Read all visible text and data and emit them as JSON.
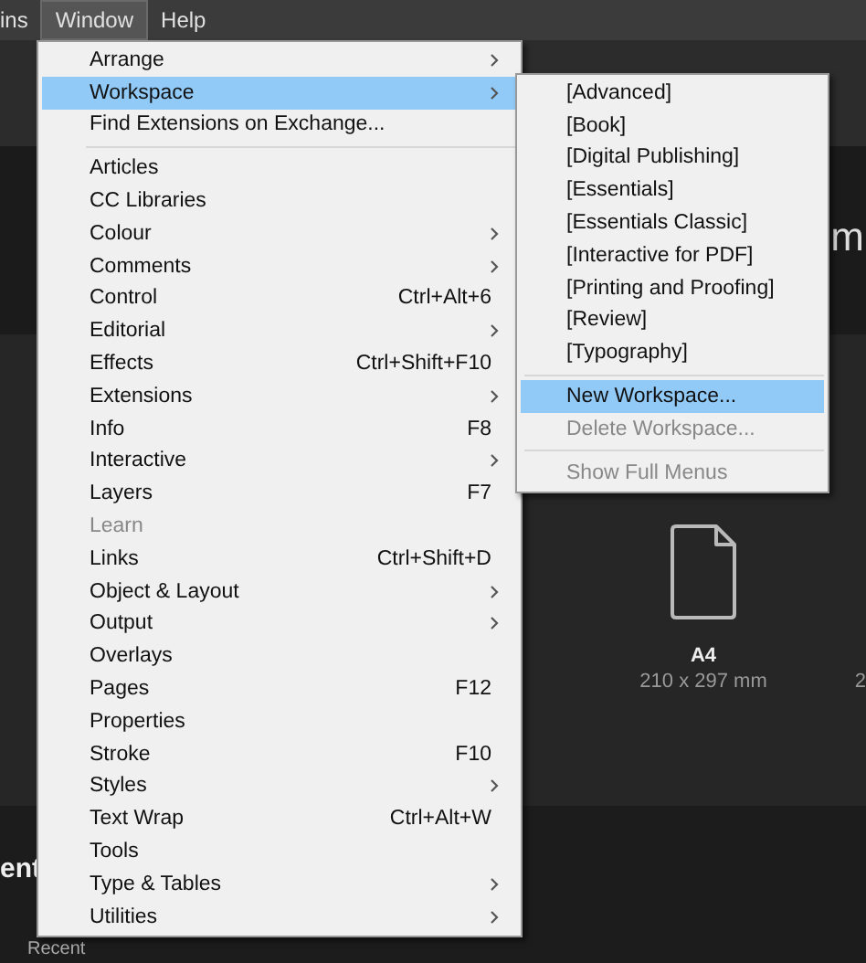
{
  "menubar": [
    {
      "label": "ins",
      "selected": false
    },
    {
      "label": "Window",
      "selected": true
    },
    {
      "label": "Help",
      "selected": false
    }
  ],
  "window_menu": [
    {
      "kind": "item",
      "label": "Arrange",
      "submenu": true,
      "highlighted": false,
      "disabled": false
    },
    {
      "kind": "item",
      "label": "Workspace",
      "submenu": true,
      "highlighted": true,
      "disabled": false
    },
    {
      "kind": "item",
      "label": "Find Extensions on Exchange...",
      "submenu": false,
      "highlighted": false,
      "disabled": false
    },
    {
      "kind": "separator"
    },
    {
      "kind": "item",
      "label": "Articles",
      "submenu": false,
      "highlighted": false,
      "disabled": false
    },
    {
      "kind": "item",
      "label": "CC Libraries",
      "submenu": false,
      "highlighted": false,
      "disabled": false
    },
    {
      "kind": "item",
      "label": "Colour",
      "submenu": true,
      "highlighted": false,
      "disabled": false
    },
    {
      "kind": "item",
      "label": "Comments",
      "submenu": true,
      "highlighted": false,
      "disabled": false
    },
    {
      "kind": "item",
      "label": "Control",
      "shortcut": "Ctrl+Alt+6",
      "submenu": false,
      "highlighted": false,
      "disabled": false
    },
    {
      "kind": "item",
      "label": "Editorial",
      "submenu": true,
      "highlighted": false,
      "disabled": false
    },
    {
      "kind": "item",
      "label": "Effects",
      "shortcut": "Ctrl+Shift+F10",
      "submenu": false,
      "highlighted": false,
      "disabled": false
    },
    {
      "kind": "item",
      "label": "Extensions",
      "submenu": true,
      "highlighted": false,
      "disabled": false
    },
    {
      "kind": "item",
      "label": "Info",
      "shortcut": "F8",
      "submenu": false,
      "highlighted": false,
      "disabled": false
    },
    {
      "kind": "item",
      "label": "Interactive",
      "submenu": true,
      "highlighted": false,
      "disabled": false
    },
    {
      "kind": "item",
      "label": "Layers",
      "shortcut": "F7",
      "submenu": false,
      "highlighted": false,
      "disabled": false
    },
    {
      "kind": "item",
      "label": "Learn",
      "submenu": false,
      "highlighted": false,
      "disabled": true
    },
    {
      "kind": "item",
      "label": "Links",
      "shortcut": "Ctrl+Shift+D",
      "submenu": false,
      "highlighted": false,
      "disabled": false
    },
    {
      "kind": "item",
      "label": "Object & Layout",
      "submenu": true,
      "highlighted": false,
      "disabled": false
    },
    {
      "kind": "item",
      "label": "Output",
      "submenu": true,
      "highlighted": false,
      "disabled": false
    },
    {
      "kind": "item",
      "label": "Overlays",
      "submenu": false,
      "highlighted": false,
      "disabled": false
    },
    {
      "kind": "item",
      "label": "Pages",
      "shortcut": "F12",
      "submenu": false,
      "highlighted": false,
      "disabled": false
    },
    {
      "kind": "item",
      "label": "Properties",
      "submenu": false,
      "highlighted": false,
      "disabled": false
    },
    {
      "kind": "item",
      "label": "Stroke",
      "shortcut": "F10",
      "submenu": false,
      "highlighted": false,
      "disabled": false
    },
    {
      "kind": "item",
      "label": "Styles",
      "submenu": true,
      "highlighted": false,
      "disabled": false
    },
    {
      "kind": "item",
      "label": "Text Wrap",
      "shortcut": "Ctrl+Alt+W",
      "submenu": false,
      "highlighted": false,
      "disabled": false
    },
    {
      "kind": "item",
      "label": "Tools",
      "submenu": false,
      "highlighted": false,
      "disabled": false
    },
    {
      "kind": "item",
      "label": "Type & Tables",
      "submenu": true,
      "highlighted": false,
      "disabled": false
    },
    {
      "kind": "item",
      "label": "Utilities",
      "submenu": true,
      "highlighted": false,
      "disabled": false
    }
  ],
  "workspace_menu": [
    {
      "kind": "item",
      "label": "[Advanced]",
      "highlighted": false,
      "disabled": false
    },
    {
      "kind": "item",
      "label": "[Book]",
      "highlighted": false,
      "disabled": false
    },
    {
      "kind": "item",
      "label": "[Digital Publishing]",
      "highlighted": false,
      "disabled": false
    },
    {
      "kind": "item",
      "label": "[Essentials]",
      "highlighted": false,
      "disabled": false
    },
    {
      "kind": "item",
      "label": "[Essentials Classic]",
      "highlighted": false,
      "disabled": false
    },
    {
      "kind": "item",
      "label": "[Interactive for PDF]",
      "highlighted": false,
      "disabled": false
    },
    {
      "kind": "item",
      "label": "[Printing and Proofing]",
      "highlighted": false,
      "disabled": false
    },
    {
      "kind": "item",
      "label": "[Review]",
      "highlighted": false,
      "disabled": false
    },
    {
      "kind": "item",
      "label": "[Typography]",
      "highlighted": false,
      "disabled": false
    },
    {
      "kind": "separator"
    },
    {
      "kind": "item",
      "label": "New Workspace...",
      "highlighted": true,
      "disabled": false
    },
    {
      "kind": "item",
      "label": "Delete Workspace...",
      "highlighted": false,
      "disabled": true
    },
    {
      "kind": "separator"
    },
    {
      "kind": "item",
      "label": "Show Full Menus",
      "highlighted": false,
      "disabled": true
    }
  ],
  "background": {
    "heading_fragment": "m",
    "section_fragment": "ent",
    "filter": "Recent",
    "presets": [
      {
        "name": "A4",
        "size": "210 x 297 mm"
      }
    ],
    "next_preset_fragment": "2"
  }
}
